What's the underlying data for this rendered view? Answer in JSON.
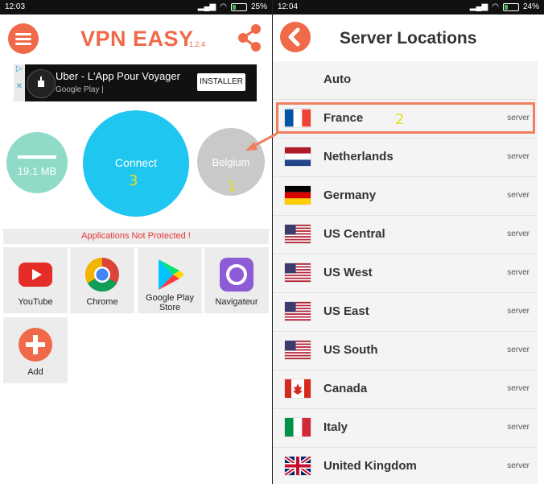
{
  "left": {
    "status": {
      "time": "12:03",
      "battery": "25%",
      "battery_level": 0.25
    },
    "header": {
      "brand": "VPN EASY",
      "version": "1.2.4"
    },
    "ad": {
      "title": "Uber - L'App Pour Voyager",
      "subtitle": "Google Play  |",
      "cta": "INSTALLER"
    },
    "data_usage": "19.1 MB",
    "connect_label": "Connect",
    "location_label": "Belgium",
    "steps": {
      "one": "1",
      "two": "2",
      "three": "3"
    },
    "warning": "Applications Not Protected !",
    "apps": [
      {
        "label": "YouTube",
        "icon": "youtube-icon"
      },
      {
        "label": "Chrome",
        "icon": "chrome-icon"
      },
      {
        "label": "Google Play Store",
        "icon": "play-store-icon"
      },
      {
        "label": "Navigateur",
        "icon": "browser-icon"
      },
      {
        "label": "Add",
        "icon": "plus-icon"
      }
    ]
  },
  "right": {
    "status": {
      "time": "12:04",
      "battery": "24%",
      "battery_level": 0.24
    },
    "title": "Server Locations",
    "servers": [
      {
        "name": "Auto",
        "tag": ""
      },
      {
        "name": "France",
        "tag": "server"
      },
      {
        "name": "Netherlands",
        "tag": "server"
      },
      {
        "name": "Germany",
        "tag": "server"
      },
      {
        "name": "US Central",
        "tag": "server"
      },
      {
        "name": "US West",
        "tag": "server"
      },
      {
        "name": "US East",
        "tag": "server"
      },
      {
        "name": "US South",
        "tag": "server"
      },
      {
        "name": "Canada",
        "tag": "server"
      },
      {
        "name": "Italy",
        "tag": "server"
      },
      {
        "name": "United Kingdom",
        "tag": "server"
      }
    ]
  },
  "colors": {
    "accent": "#f06a4a",
    "connect": "#1ec6f0",
    "data": "#8fdbc7",
    "warning": "#e53935",
    "annotation": "#e0e02a"
  }
}
